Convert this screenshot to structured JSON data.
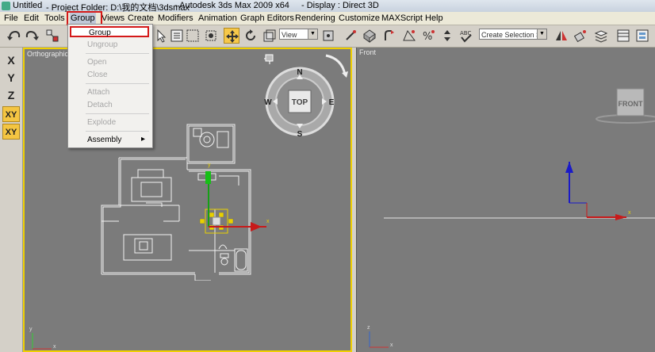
{
  "titlebar": {
    "doc": "Untitled",
    "project": "- Project Folder: D:\\我的文档\\3dsmax",
    "app": "- Autodesk 3ds Max  2009 x64",
    "display": "- Display : Direct 3D"
  },
  "menu": [
    "File",
    "Edit",
    "Tools",
    "Group",
    "Views",
    "Create",
    "Modifiers",
    "Animation",
    "Graph Editors",
    "Rendering",
    "Customize",
    "MAXScript",
    "Help"
  ],
  "group_menu": {
    "group": "Group",
    "ungroup": "Ungroup",
    "open": "Open",
    "close": "Close",
    "attach": "Attach",
    "detach": "Detach",
    "explode": "Explode",
    "assembly": "Assembly",
    "assembly_arrow": "▸"
  },
  "toolbar": {
    "coord_system": "View",
    "selection_set": "Create Selection Set"
  },
  "axis_constraints": [
    "X",
    "Y",
    "Z",
    "XY",
    "XY"
  ],
  "viewports": {
    "left": {
      "label": "Orthographic",
      "viewcube_label": "TOP",
      "compass": [
        "N",
        "S",
        "E",
        "W"
      ]
    },
    "right": {
      "label": "Front",
      "viewcube_label": "FRONT"
    }
  },
  "axis_labels": {
    "x": "x",
    "y": "y",
    "z": "z"
  },
  "colors": {
    "active_border": "#f0d000",
    "highlight": "#d41919",
    "viewport_bg": "#7b7b7b"
  }
}
